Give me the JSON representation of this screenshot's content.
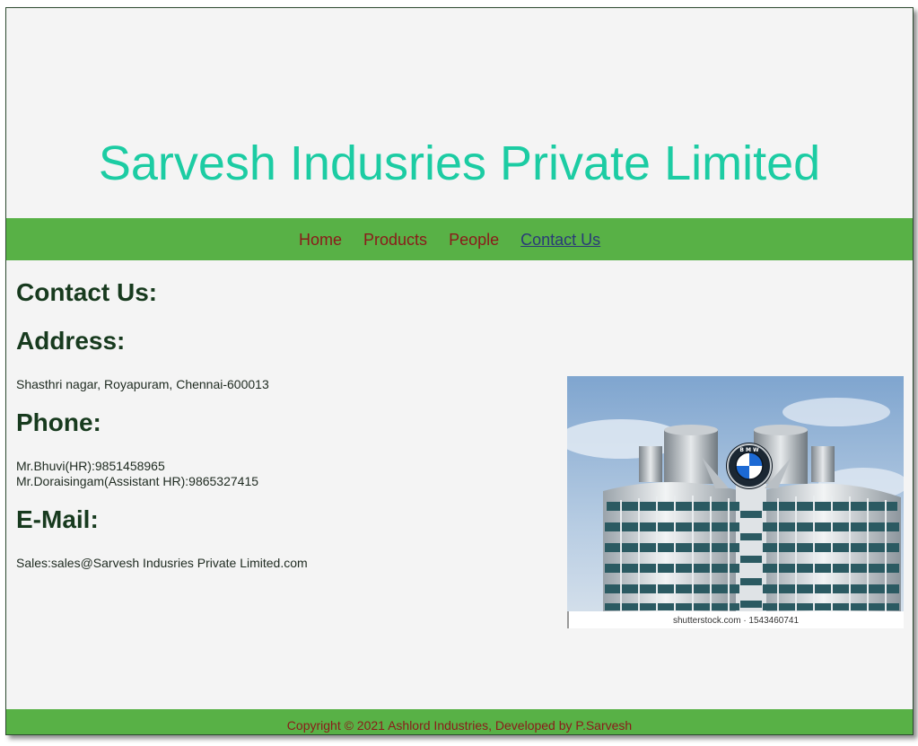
{
  "header": {
    "site_title": "Sarvesh Indusries Private Limited"
  },
  "nav": {
    "items": [
      {
        "label": "Home",
        "active": false
      },
      {
        "label": "Products",
        "active": false
      },
      {
        "label": "People",
        "active": false
      },
      {
        "label": "Contact Us",
        "active": true
      }
    ]
  },
  "main": {
    "heading": "Contact Us:",
    "address_heading": "Address:",
    "address": "Shasthri nagar, Royapuram, Chennai-600013",
    "phone_heading": "Phone:",
    "phone_lines": [
      "Mr.Bhuvi(HR):9851458965",
      "Mr.Doraisingam(Assistant HR):9865327415"
    ],
    "email_heading": "E-Mail:",
    "email": "Sales:sales@Sarvesh Indusries Private Limited.com",
    "image": {
      "watermark": "shutterstock.com · 1543460741"
    }
  },
  "footer": {
    "text": "Copyright © 2021 Ashlord Industries, Developed by P.Sarvesh"
  },
  "colors": {
    "title": "#1ccca3",
    "nav_bar": "#58b146",
    "nav_link": "#8b1a1a",
    "nav_link_active": "#2a3a78",
    "heading": "#173a1e",
    "page_bg": "#f4f4f4"
  }
}
